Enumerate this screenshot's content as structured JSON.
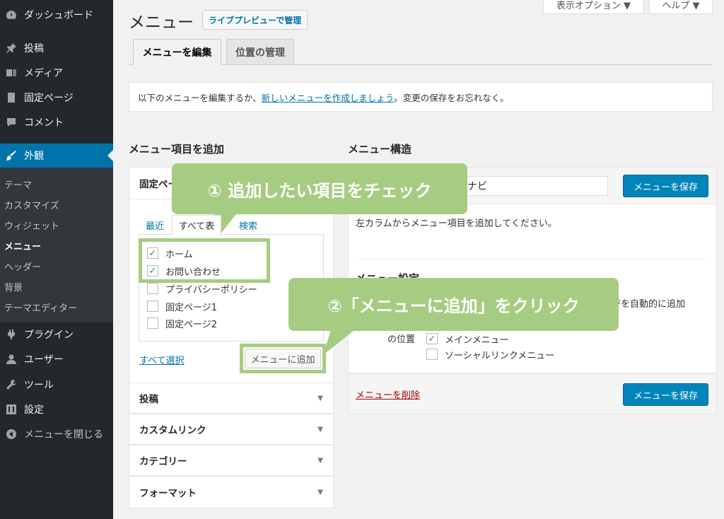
{
  "sidebar": {
    "items": [
      {
        "label": "ダッシュボード",
        "icon": "dashboard-icon"
      },
      {
        "label": "投稿",
        "icon": "pin-icon"
      },
      {
        "label": "メディア",
        "icon": "media-icon"
      },
      {
        "label": "固定ページ",
        "icon": "page-icon"
      },
      {
        "label": "コメント",
        "icon": "comment-icon"
      },
      {
        "label": "外観",
        "icon": "appearance-icon"
      },
      {
        "label": "プラグイン",
        "icon": "plugin-icon"
      },
      {
        "label": "ユーザー",
        "icon": "user-icon"
      },
      {
        "label": "ツール",
        "icon": "wrench-icon"
      },
      {
        "label": "設定",
        "icon": "settings-icon"
      },
      {
        "label": "メニューを閉じる",
        "icon": "collapse-icon"
      }
    ],
    "submenu": [
      "テーマ",
      "カスタマイズ",
      "ウィジェット",
      "メニュー",
      "ヘッダー",
      "背景",
      "テーマエディター"
    ]
  },
  "header": {
    "title": "メニュー",
    "live_preview": "ライブプレビューで管理",
    "screen_options": "表示オプション ▼",
    "help": "ヘルプ ▼"
  },
  "tabs": {
    "edit": "メニューを編集",
    "locations": "位置の管理"
  },
  "notice": {
    "before": "以下のメニューを編集するか、",
    "link": "新しいメニューを作成しましょう",
    "after": "。変更の保存をお忘れなく。"
  },
  "left": {
    "title": "メニュー項目を追加",
    "pages_header": "固定ペー",
    "inner_tabs": [
      "最近",
      "すべて表",
      "検索"
    ],
    "pages": [
      {
        "label": "ホーム",
        "checked": true
      },
      {
        "label": "お問い合わせ",
        "checked": true
      },
      {
        "label": "プライバシーポリシー",
        "checked": false
      },
      {
        "label": "固定ページ1",
        "checked": false
      },
      {
        "label": "固定ページ2",
        "checked": false
      }
    ],
    "select_all": "すべて選択",
    "add_button": "メニューに追加",
    "accordion": [
      "投稿",
      "カスタムリンク",
      "カテゴリー",
      "フォーマット"
    ],
    "arrow": "▼"
  },
  "right": {
    "title": "メニュー構造",
    "menu_name_suffix": "ナビ",
    "save_label": "メニューを保存",
    "instruction": "左カラムからメニュー項目を追加してください。",
    "settings_title": "メニュー設定",
    "auto_add_tail": "ジを自動的に追加",
    "location_label": "の位置",
    "locations": [
      {
        "label": "メインメニュー",
        "checked": true
      },
      {
        "label": "ソーシャルリンクメニュー",
        "checked": false
      }
    ],
    "delete_label": "メニューを削除"
  },
  "callouts": {
    "step1": "① 追加したい項目をチェック",
    "step2": "②「メニューに追加」をクリック"
  },
  "colors": {
    "accent": "#0073aa",
    "primary_button": "#0085ba",
    "callout": "#a6cc82",
    "sidebar": "#23282d",
    "delete": "#a00"
  }
}
